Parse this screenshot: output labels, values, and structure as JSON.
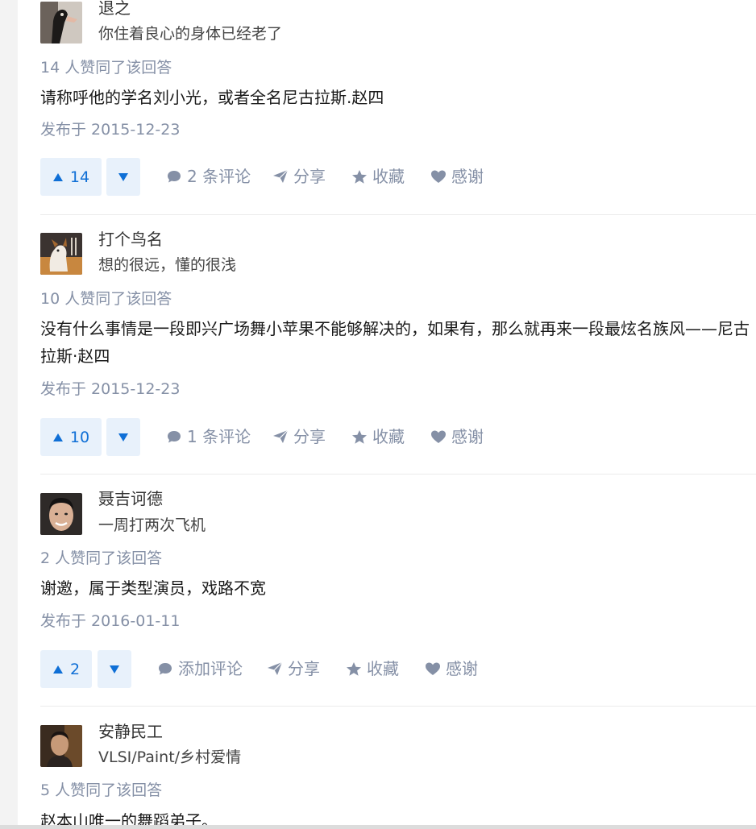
{
  "answers": [
    {
      "author": "退之",
      "bio": "你住着良心的身体已经老了",
      "upvotes": "14 人赞同了该回答",
      "text_lines": [
        "请称呼他的学名刘小光，或者全名尼古拉斯.赵四"
      ],
      "date": "发布于 2015-12-23",
      "vote_count": "14",
      "comment": "2 条评论",
      "share": "分享",
      "favorite": "收藏",
      "thanks": "感谢"
    },
    {
      "author": "打个鸟名",
      "bio": "想的很远，懂的很浅",
      "upvotes": "10 人赞同了该回答",
      "text_lines": [
        "没有什么事情是一段即兴广场舞小苹果不能够解决的，如果有，那么就再来一段最炫名族风——尼古",
        "拉斯·赵四"
      ],
      "date": "发布于 2015-12-23",
      "vote_count": "10",
      "comment": "1 条评论",
      "share": "分享",
      "favorite": "收藏",
      "thanks": "感谢"
    },
    {
      "author": "聂吉诃德",
      "bio": "一周打两次飞机",
      "upvotes": "2 人赞同了该回答",
      "text_lines": [
        "谢邀，属于类型演员，戏路不宽"
      ],
      "date": "发布于 2016-01-11",
      "vote_count": "2",
      "comment": "添加评论",
      "share": "分享",
      "favorite": "收藏",
      "thanks": "感谢"
    },
    {
      "author": "安静民工",
      "bio": "VLSI/Paint/乡村爱情",
      "upvotes": "5 人赞同了该回答",
      "text_lines": [
        "赵本山唯一的舞蹈弟子。"
      ]
    }
  ],
  "colors": {
    "meta_gray": "#8590a6",
    "vote_bg": "#e8f1fb",
    "vote_blue": "#0f6fd6",
    "text": "#1a1a1a"
  },
  "icons": {
    "vote_up": "triangle-up-icon",
    "vote_down": "triangle-down-icon",
    "comment": "speech-bubble-icon",
    "share": "paper-plane-icon",
    "favorite": "star-icon",
    "thanks": "heart-icon"
  }
}
